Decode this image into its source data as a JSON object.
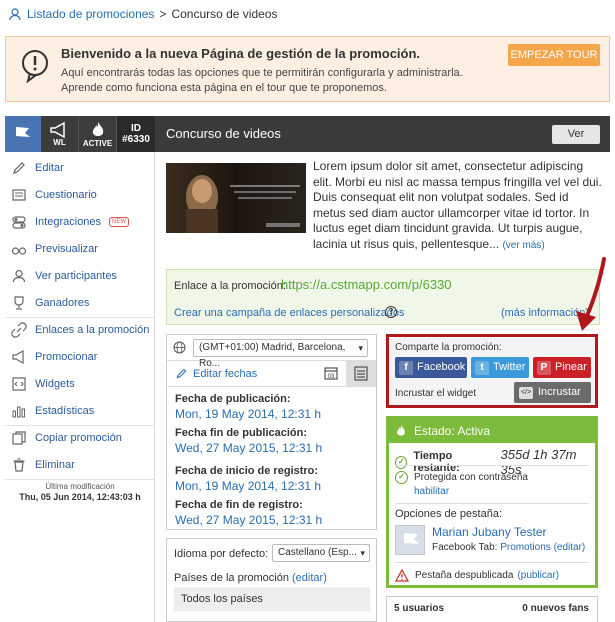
{
  "breadcrumb": {
    "parent": "Listado de promociones",
    "separator": ">",
    "current": "Concurso de videos"
  },
  "banner": {
    "title": "Bienvenido a la nueva Página de gestión de la promoción.",
    "line1": "Aquí encontrarás todas las opciones que te permitirán configurarla y administrarla.",
    "line2": "Aprende como funciona esta página en el tour que te proponemos.",
    "tour_button": "EMPEZAR TOUR"
  },
  "header": {
    "wl_label": "WL",
    "active_label": "ACTIVE",
    "id_label": "ID",
    "id_value": "#6330",
    "title": "Concurso de videos",
    "ver_button": "Ver"
  },
  "sidebar": {
    "items": [
      {
        "label": "Editar",
        "icon": "pencil-icon"
      },
      {
        "label": "Cuestionario",
        "icon": "form-icon"
      },
      {
        "label": "Integraciones",
        "icon": "toggle-icon",
        "badge": "NEW"
      },
      {
        "label": "Previsualizar",
        "icon": "glasses-icon"
      },
      {
        "label": "Ver participantes",
        "icon": "user-icon"
      },
      {
        "label": "Ganadores",
        "icon": "trophy-icon"
      },
      {
        "label": "Enlaces a la promoción",
        "icon": "link-icon"
      },
      {
        "label": "Promocionar",
        "icon": "megaphone-icon"
      },
      {
        "label": "Widgets",
        "icon": "code-icon"
      },
      {
        "label": "Estadísticas",
        "icon": "bar-chart-icon"
      },
      {
        "label": "Copiar promoción",
        "icon": "copy-icon"
      },
      {
        "label": "Eliminar",
        "icon": "trash-icon"
      }
    ],
    "last_modified_label": "Última modificación",
    "last_modified_value": "Thu, 05 Jun 2014, 12:43:03 h"
  },
  "description": {
    "text": "Lorem ipsum dolor sit amet, consectetur adipiscing elit. Morbi eu nisl ac massa tempus fringilla vel vel dui. Duis consequat elit non volutpat sodales. Sed id metus sed diam auctor ullamcorper vitae id tortor. In luctus eget diam tincidunt gravida. Ut turpis augue, lacinia ut risus quis, pellentesque...",
    "more_link": "(ver más)"
  },
  "links": {
    "label": "Enlace a la promoción:",
    "url": "https://a.cstmapp.com/p/6330",
    "create_campaign": "Crear una campaña de enlaces personalizados",
    "help": "?",
    "more_info": "(más información)"
  },
  "dates": {
    "timezone": "(GMT+01:00) Madrid, Barcelona, Ro...",
    "edit_dates": "Editar fechas",
    "calendar_day": "03",
    "publication_start_label": "Fecha de publicación:",
    "publication_start": "Mon, 19 May 2014, 12:31 h",
    "publication_end_label": "Fecha fin de publicación:",
    "publication_end": "Wed, 27 May 2015, 12:31 h",
    "registration_start_label": "Fecha de inicio de registro:",
    "registration_start": "Mon, 19 May 2014, 12:31 h",
    "registration_end_label": "Fecha de fin de registro:",
    "registration_end": "Wed, 27 May 2015, 12:31 h"
  },
  "language": {
    "label": "Idioma por defecto:",
    "selected": "Castellano (Esp...",
    "countries_label": "Países de la promoción",
    "countries_edit": "(editar)",
    "countries_value": "Todos los países"
  },
  "share": {
    "title": "Comparte la promoción:",
    "facebook": "Facebook",
    "twitter": "Twitter",
    "pinterest": "Pinear",
    "embed_label": "Incrustar el widget",
    "embed_button": "Incrustar",
    "embed_icon_text": "</>"
  },
  "status": {
    "title": "Estado: Activa",
    "remaining_label": "Tiempo restante:",
    "remaining_value": "355d 1h 37m 35s",
    "password_text": "Protegida con contraseña",
    "password_link": "habilitar",
    "tab_options_label": "Opciones de pestaña:",
    "tab_user": "Marian Jubany Tester",
    "tab_label": "Facebook Tab:",
    "tab_promotions": "Promotions",
    "tab_edit": "(editar)",
    "unpublished_text": "Pestaña despublicada",
    "unpublished_link": "(publicar)"
  },
  "stats": {
    "users": "5 usuarios",
    "fans": "0 nuevos fans"
  },
  "colors": {
    "accent": "#4a74b4",
    "active_green": "#7dbb3d",
    "highlight_red": "#b0181e",
    "tour_orange": "#f5a54a"
  }
}
